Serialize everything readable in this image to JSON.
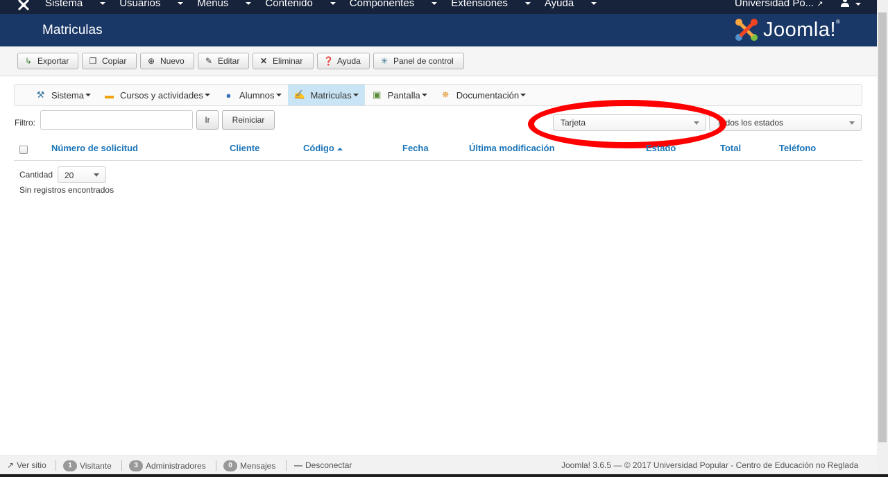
{
  "topnav": {
    "logo_icon": "joomla-icon",
    "menus": [
      {
        "label": "Sistema"
      },
      {
        "label": "Usuarios"
      },
      {
        "label": "Menús"
      },
      {
        "label": "Contenido"
      },
      {
        "label": "Componentes"
      },
      {
        "label": "Extensiones"
      },
      {
        "label": "Ayuda"
      }
    ],
    "site_link": "Universidad Po...",
    "user_icon": "user-icon"
  },
  "header": {
    "title": "Matriculas",
    "brand": "Joomla!"
  },
  "toolbar": {
    "buttons": [
      {
        "label": "Exportar",
        "icon": "export-icon"
      },
      {
        "label": "Copiar",
        "icon": "copy-icon"
      },
      {
        "label": "Nuevo",
        "icon": "plus-circle-icon"
      },
      {
        "label": "Editar",
        "icon": "edit-icon"
      },
      {
        "label": "Eliminar",
        "icon": "close-icon"
      },
      {
        "label": "Ayuda",
        "icon": "question-circle-icon"
      },
      {
        "label": "Panel de control",
        "icon": "asterisk-icon"
      }
    ]
  },
  "submenu": {
    "items": [
      {
        "label": "Sistema",
        "icon": "tools-icon",
        "active": false
      },
      {
        "label": "Cursos y actividades",
        "icon": "folder-icon",
        "active": false
      },
      {
        "label": "Alumnos",
        "icon": "users-icon",
        "active": false
      },
      {
        "label": "Matriculas",
        "icon": "document-pen-icon",
        "active": true
      },
      {
        "label": "Pantalla",
        "icon": "screen-icon",
        "active": false
      },
      {
        "label": "Documentación",
        "icon": "gear-doc-icon",
        "active": false
      }
    ]
  },
  "filters": {
    "label": "Filtro:",
    "search_value": "",
    "go_label": "Ir",
    "reset_label": "Reiniciar",
    "payment_select": "Tarjeta",
    "state_select": "Todos los estados"
  },
  "table": {
    "columns": [
      {
        "label": "Número de solicitud",
        "sorted": false
      },
      {
        "label": "Cliente",
        "sorted": false
      },
      {
        "label": "Código",
        "sorted": true
      },
      {
        "label": "Fecha",
        "sorted": false
      },
      {
        "label": "Última modificación",
        "sorted": false
      },
      {
        "label": "Estado",
        "sorted": false
      },
      {
        "label": "Total",
        "sorted": false
      },
      {
        "label": "Teléfono",
        "sorted": false
      }
    ],
    "rows": []
  },
  "pagination": {
    "count_label": "Cantidad",
    "count_value": "20",
    "empty_message": "Sin registros encontrados"
  },
  "footer": {
    "view_site": "Ver sitio",
    "visitors_count": "1",
    "visitors_label": "Visitante",
    "admins_count": "3",
    "admins_label": "Administradores",
    "messages_count": "0",
    "messages_label": "Mensajes",
    "logout": "Desconectar",
    "copyright": "Joomla! 3.6.5 — © 2017 Universidad Popular - Centro de Educación no Reglada"
  },
  "colors": {
    "topnav_bg": "#17233a",
    "header_bg": "#1a3867",
    "link_blue": "#1a74b8",
    "annotation_red": "#ff0000"
  }
}
